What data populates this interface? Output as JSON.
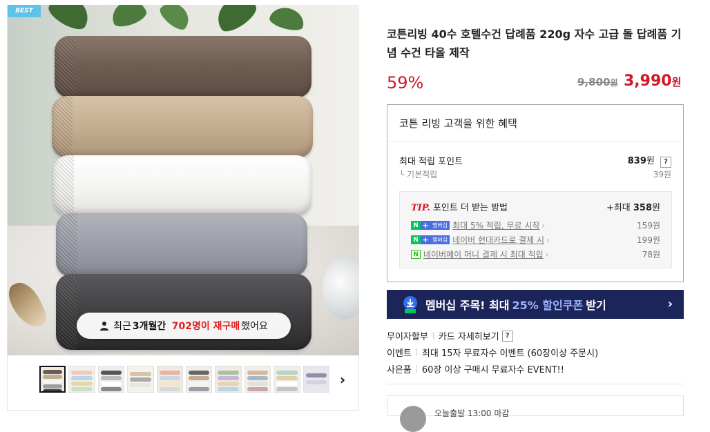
{
  "gallery": {
    "badge": "BEST",
    "repurchase": {
      "prefix": "최근 ",
      "period": "3개월간",
      "count": "702명이 재구매",
      "suffix": " 했어요"
    },
    "thumbnail_count": 10,
    "next_icon": "chevron-right-icon"
  },
  "product": {
    "title": "코튼리빙 40수 호텔수건 답례품 220g 자수 고급 돌 답례품 기념 수건 타올 제작",
    "discount": "59%",
    "original_price": "9,800",
    "original_unit": "원",
    "sale_price": "3,990",
    "sale_unit": "원"
  },
  "benefit": {
    "heading": "코튼 리빙 고객을 위한 혜택",
    "max_points_label": "최대 적립 포인트",
    "max_points_value": "839",
    "max_points_unit": "원",
    "help": "?",
    "base_label": "기본적립",
    "base_value": "39원",
    "tip": {
      "label": "TIP.",
      "text": "포인트 더 받는 방법",
      "max_prefix": "+최대 ",
      "max_value": "358",
      "max_unit": "원",
      "rows": [
        {
          "tag": "멤버십",
          "text": "최대 5% 적립, 무료 시작",
          "value": "159원"
        },
        {
          "tag": "멤버십",
          "text": "네이버 현대카드로 결제 시",
          "value": "199원"
        },
        {
          "text": "네이버페이 머니 결제 시 최대 적립",
          "value": "78원"
        }
      ]
    }
  },
  "banner": {
    "before": "멤버십 주목! 최대",
    "highlight": "25% 할인쿠폰",
    "after": "받기",
    "arrow": "›"
  },
  "meta": {
    "installment": "무이자할부",
    "card_details": "카드 자세히보기",
    "help": "?",
    "event_label": "이벤트",
    "event_text": "최대 15자 무료자수 이벤트 (60장이상 주문시)",
    "gift_label": "사은품",
    "gift_text": "60장 이상 구매시 무료자수 EVENT!!"
  },
  "shipping": {
    "text": "오늘출발 13:00 마감"
  },
  "colors": {
    "price_red": "#d31625",
    "banner_navy": "#1c2559",
    "badge_blue": "#5dc3e8",
    "naver_green": "#03c75a"
  }
}
